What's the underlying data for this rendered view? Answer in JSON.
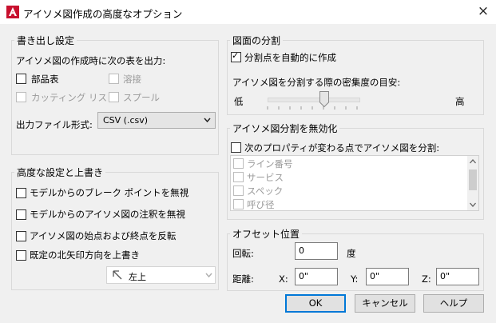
{
  "window": {
    "title": "アイソメ図作成の高度なオプション",
    "close_icon": "×"
  },
  "export_settings": {
    "title": "書き出し設定",
    "output_label": "アイソメ図の作成時に次の表を出力:",
    "bom": "部品表",
    "welds": "溶接",
    "cut_list": "カッティング リスト",
    "spools": "スプール",
    "format_label": "出力ファイル形式:",
    "format_value": "CSV (.csv)"
  },
  "drawing_split": {
    "title": "図面の分割",
    "auto_split": "分割点を自動的に作成",
    "density_label": "アイソメ図を分割する際の密集度の目安:",
    "low": "低",
    "high": "高"
  },
  "advanced": {
    "title": "高度な設定と上書き",
    "ignore_breaks": "モデルからのブレーク ポイントを無視",
    "ignore_annotations": "モデルからのアイソメ図の注釈を無視",
    "reverse_ends": "アイソメ図の始点および終点を反転",
    "override_north": "既定の北矢印方向を上書き",
    "north_value": "左上"
  },
  "disable_split": {
    "title": "アイソメ図分割を無効化",
    "props_label": "次のプロパティが変わる点でアイソメ図を分割:",
    "props": [
      "ライン番号",
      "サービス",
      "スペック",
      "呼び径"
    ]
  },
  "offset": {
    "title": "オフセット位置",
    "rotation_label": "回転:",
    "rotation_value": "0",
    "degree": "度",
    "distance_label": "距離:",
    "x_label": "X:",
    "x_value": "0\"",
    "y_label": "Y:",
    "y_value": "0\"",
    "z_label": "Z:",
    "z_value": "0\""
  },
  "buttons": {
    "ok": "OK",
    "cancel": "キャンセル",
    "help": "ヘルプ"
  },
  "colors": {
    "accent": "#0078d7",
    "logo": "#c8102e"
  }
}
